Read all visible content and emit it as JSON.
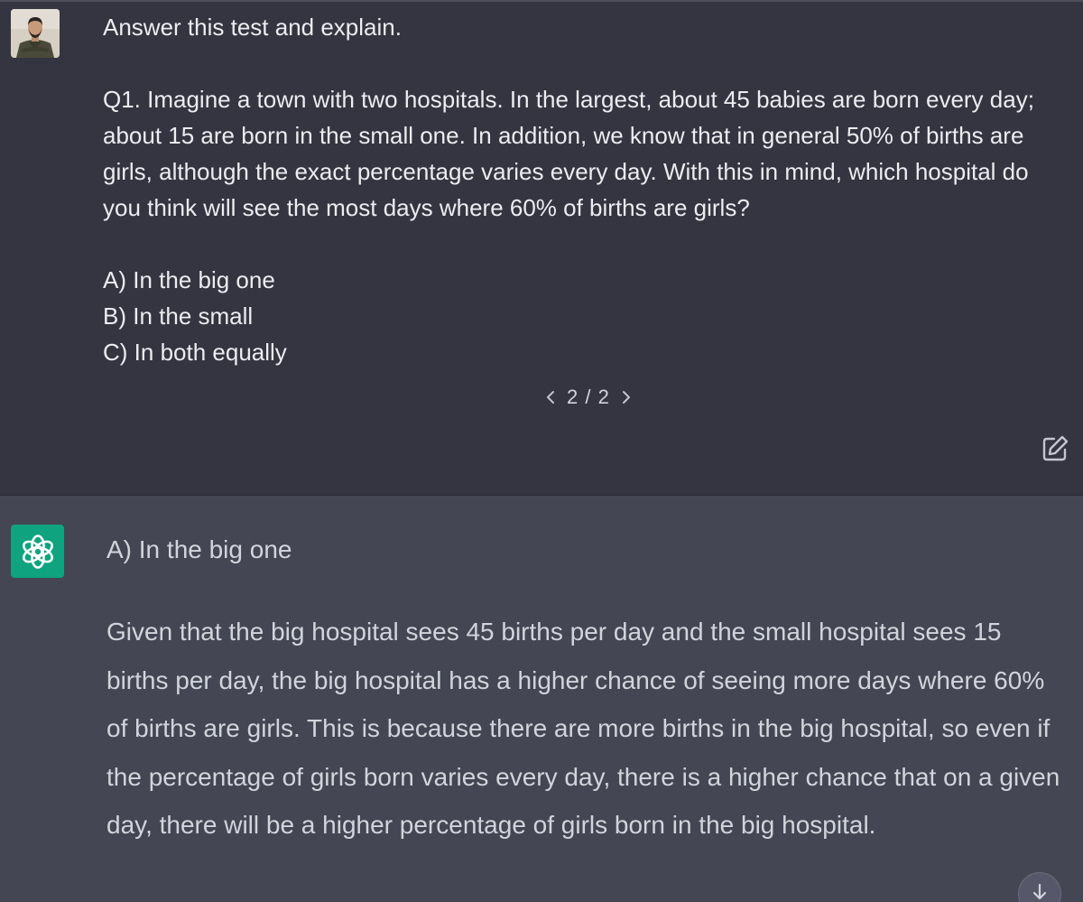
{
  "user_message": {
    "avatar_icon": "user-photo-avatar",
    "prompt_line": "Answer this test and explain.",
    "question": "Q1. Imagine a town with two hospitals. In the largest, about 45 babies are born every day; about 15 are born in the small one. In addition, we know that in general 50% of births are girls, although the exact percentage varies every day. With this in mind, which hospital do you think will see the most days where 60% of births are girls?",
    "options": [
      "A) In the big one",
      "B) In the small",
      "C) In both equally"
    ],
    "pager": {
      "prev_icon": "chevron-left-icon",
      "count": "2 / 2",
      "next_icon": "chevron-right-icon"
    },
    "edit_icon": "edit-icon"
  },
  "assistant_message": {
    "avatar_icon": "openai-logo-icon",
    "answer": "A) In the big one",
    "explanation": "Given that the big hospital sees 45 births per day and the small hospital sees 15 births per day, the big hospital has a higher chance of seeing more days where 60% of births are girls. This is because there are more births in the big hospital, so even if the percentage of girls born varies every day, there is a higher chance that on a given day, there will be a higher percentage of girls born in the big hospital."
  },
  "scroll_down_icon": "arrow-down-icon",
  "colors": {
    "user_bg": "#343541",
    "assistant_bg": "#444654",
    "user_text": "#ececf1",
    "assistant_text": "#d1d5db",
    "brand_green": "#10a37f"
  }
}
